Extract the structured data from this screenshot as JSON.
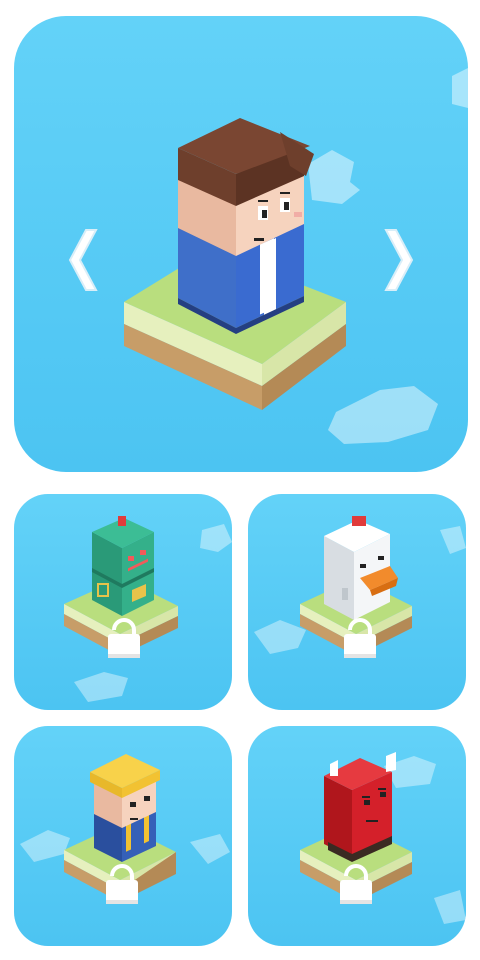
{
  "screen": "character-select",
  "selected_character": {
    "name": "office-guy",
    "locked": false
  },
  "navigation": {
    "prev_icon": "chevron-left-icon",
    "next_icon": "chevron-right-icon"
  },
  "characters": [
    {
      "name": "robot",
      "locked": true
    },
    {
      "name": "chicken",
      "locked": true
    },
    {
      "name": "construction-worker",
      "locked": true
    },
    {
      "name": "red-devil",
      "locked": true
    }
  ],
  "colors": {
    "sky": "#55c8f4",
    "grass": "#b4dc7a",
    "dirt": "#c69c66",
    "lock": "#ffffff"
  }
}
